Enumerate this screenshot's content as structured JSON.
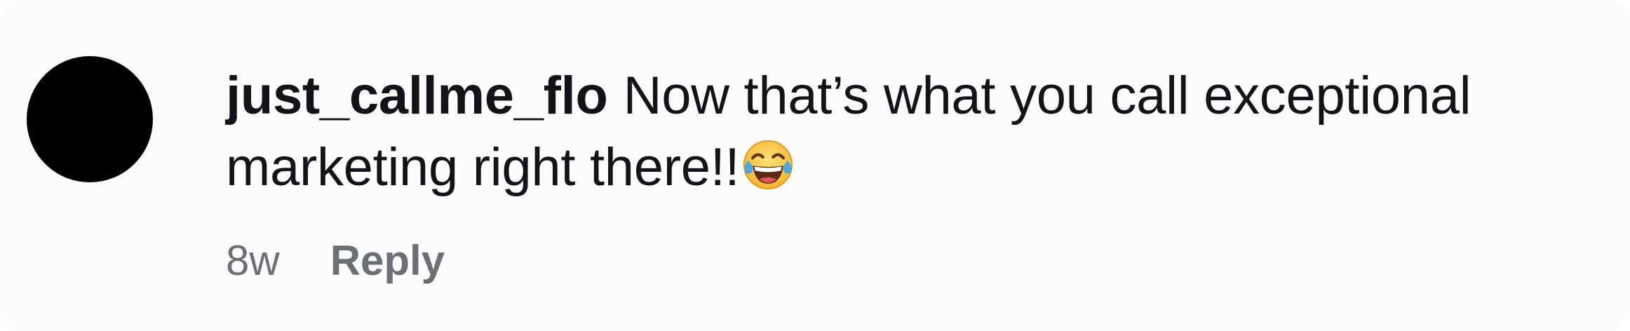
{
  "comment": {
    "username": "just_callme_flo",
    "text": "Now that’s what you call exceptional marketing right there!!",
    "emoji": "face-with-tears-of-joy-icon",
    "time": "8w",
    "reply_label": "Reply"
  },
  "colors": {
    "background": "#fcfcfd",
    "text": "#111418",
    "muted": "#6b6f76",
    "avatar": "#000000"
  }
}
